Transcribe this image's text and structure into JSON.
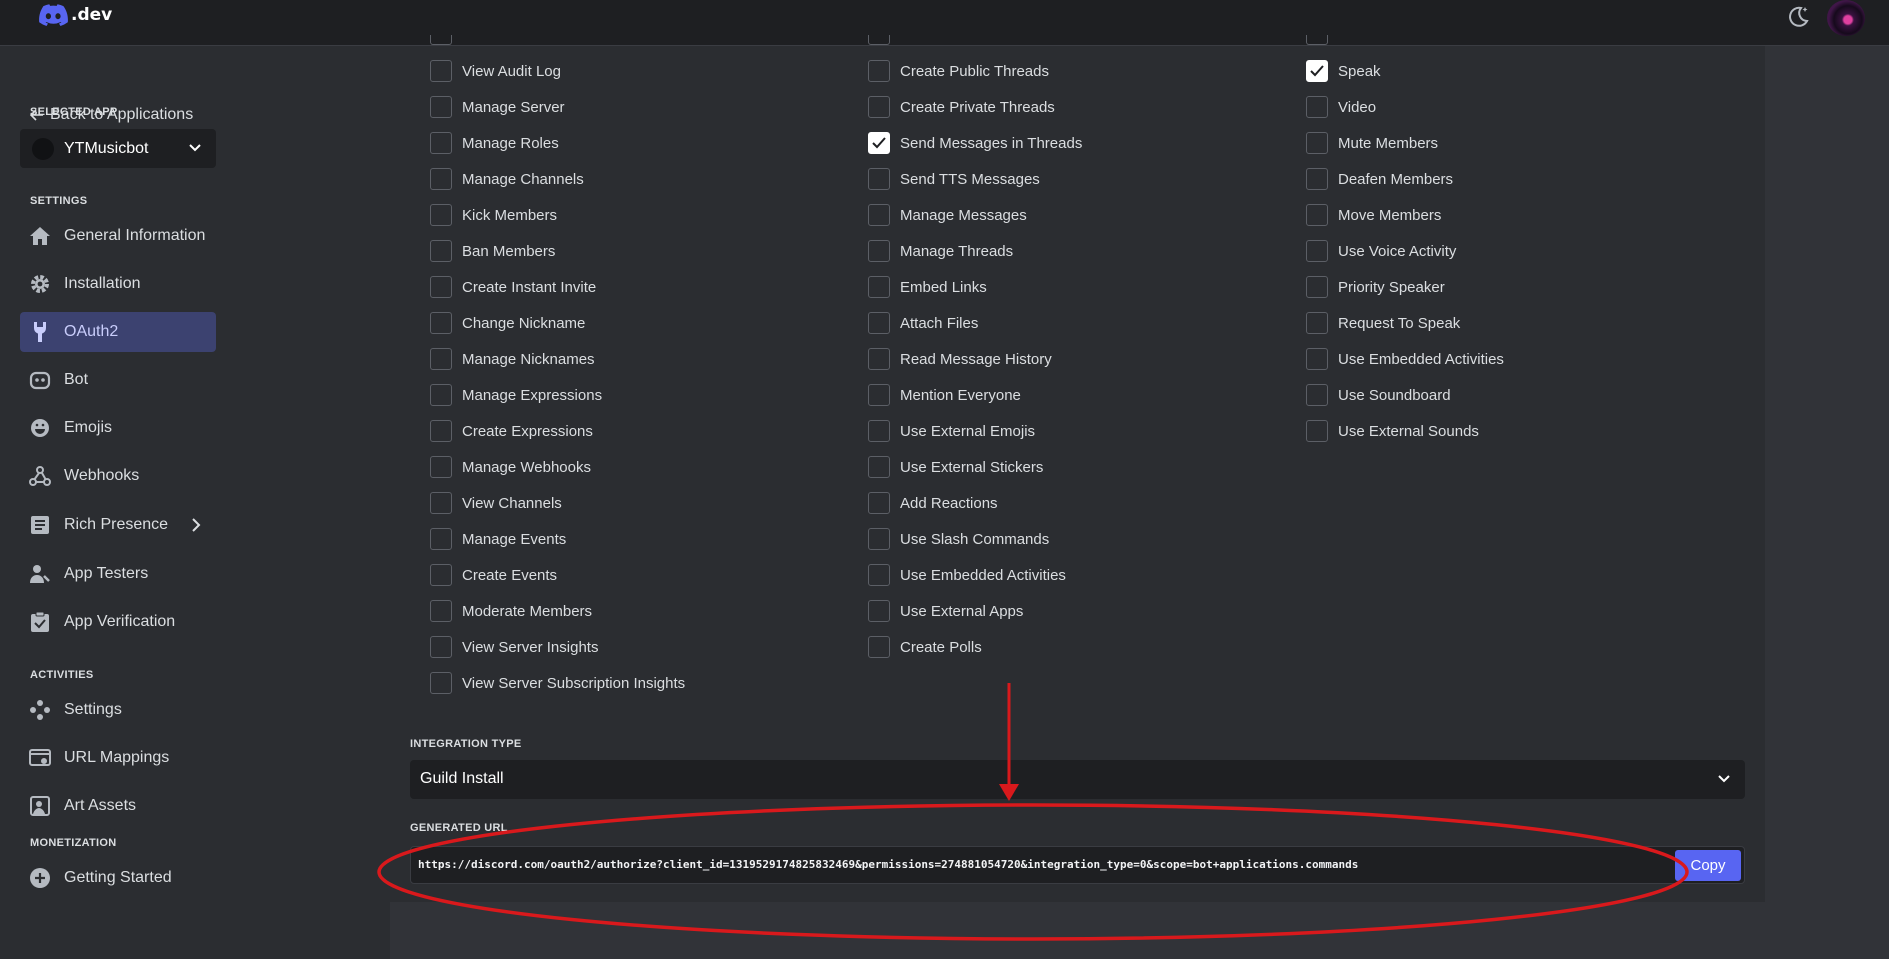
{
  "topbar": {
    "logo_text": ".dev",
    "theme_icon": "moon-icon",
    "avatar_icon": "user-avatar"
  },
  "sidebar": {
    "back_label": "Back to Applications",
    "selected_app_heading": "SELECTED APP",
    "selected_app_name": "YTMusicbot",
    "settings_heading": "SETTINGS",
    "settings_items": [
      {
        "label": "General Information",
        "icon": "home-icon"
      },
      {
        "label": "Installation",
        "icon": "gear-icon"
      },
      {
        "label": "OAuth2",
        "icon": "wrench-icon",
        "active": true
      },
      {
        "label": "Bot",
        "icon": "robot-icon"
      },
      {
        "label": "Emojis",
        "icon": "smiley-icon"
      },
      {
        "label": "Webhooks",
        "icon": "webhook-icon"
      },
      {
        "label": "Rich Presence",
        "icon": "document-icon",
        "has_submenu": true
      },
      {
        "label": "App Testers",
        "icon": "person-icon"
      },
      {
        "label": "App Verification",
        "icon": "clipboard-check-icon"
      }
    ],
    "activities_heading": "ACTIVITIES",
    "activities_items": [
      {
        "label": "Settings",
        "icon": "gamepad-icon"
      },
      {
        "label": "URL Mappings",
        "icon": "url-mapping-icon"
      },
      {
        "label": "Art Assets",
        "icon": "image-icon"
      }
    ],
    "monetization_heading": "MONETIZATION",
    "monetization_items": [
      {
        "label": "Getting Started",
        "icon": "plus-circle-icon"
      }
    ]
  },
  "permissions": {
    "col1": [
      {
        "label": "View Audit Log",
        "checked": false
      },
      {
        "label": "Manage Server",
        "checked": false
      },
      {
        "label": "Manage Roles",
        "checked": false
      },
      {
        "label": "Manage Channels",
        "checked": false
      },
      {
        "label": "Kick Members",
        "checked": false
      },
      {
        "label": "Ban Members",
        "checked": false
      },
      {
        "label": "Create Instant Invite",
        "checked": false
      },
      {
        "label": "Change Nickname",
        "checked": false
      },
      {
        "label": "Manage Nicknames",
        "checked": false
      },
      {
        "label": "Manage Expressions",
        "checked": false
      },
      {
        "label": "Create Expressions",
        "checked": false
      },
      {
        "label": "Manage Webhooks",
        "checked": false
      },
      {
        "label": "View Channels",
        "checked": false
      },
      {
        "label": "Manage Events",
        "checked": false
      },
      {
        "label": "Create Events",
        "checked": false
      },
      {
        "label": "Moderate Members",
        "checked": false
      },
      {
        "label": "View Server Insights",
        "checked": false
      },
      {
        "label": "View Server Subscription Insights",
        "checked": false
      }
    ],
    "col2": [
      {
        "label": "Create Public Threads",
        "checked": false
      },
      {
        "label": "Create Private Threads",
        "checked": false
      },
      {
        "label": "Send Messages in Threads",
        "checked": true
      },
      {
        "label": "Send TTS Messages",
        "checked": false
      },
      {
        "label": "Manage Messages",
        "checked": false
      },
      {
        "label": "Manage Threads",
        "checked": false
      },
      {
        "label": "Embed Links",
        "checked": false
      },
      {
        "label": "Attach Files",
        "checked": false
      },
      {
        "label": "Read Message History",
        "checked": false
      },
      {
        "label": "Mention Everyone",
        "checked": false
      },
      {
        "label": "Use External Emojis",
        "checked": false
      },
      {
        "label": "Use External Stickers",
        "checked": false
      },
      {
        "label": "Add Reactions",
        "checked": false
      },
      {
        "label": "Use Slash Commands",
        "checked": false
      },
      {
        "label": "Use Embedded Activities",
        "checked": false
      },
      {
        "label": "Use External Apps",
        "checked": false
      },
      {
        "label": "Create Polls",
        "checked": false
      }
    ],
    "col3": [
      {
        "label": "Speak",
        "checked": true
      },
      {
        "label": "Video",
        "checked": false
      },
      {
        "label": "Mute Members",
        "checked": false
      },
      {
        "label": "Deafen Members",
        "checked": false
      },
      {
        "label": "Move Members",
        "checked": false
      },
      {
        "label": "Use Voice Activity",
        "checked": false
      },
      {
        "label": "Priority Speaker",
        "checked": false
      },
      {
        "label": "Request To Speak",
        "checked": false
      },
      {
        "label": "Use Embedded Activities",
        "checked": false
      },
      {
        "label": "Use Soundboard",
        "checked": false
      },
      {
        "label": "Use External Sounds",
        "checked": false
      }
    ]
  },
  "integration": {
    "heading": "INTEGRATION TYPE",
    "value": "Guild Install"
  },
  "generated_url": {
    "heading": "GENERATED URL",
    "value": "https://discord.com/oauth2/authorize?client_id=1319529174825832469&permissions=274881054720&integration_type=0&scope=bot+applications.commands",
    "copy_label": "Copy"
  },
  "annotation": {
    "color": "#d9191c"
  },
  "colors": {
    "accent": "#5865f2",
    "active_nav": "#3c4270"
  }
}
